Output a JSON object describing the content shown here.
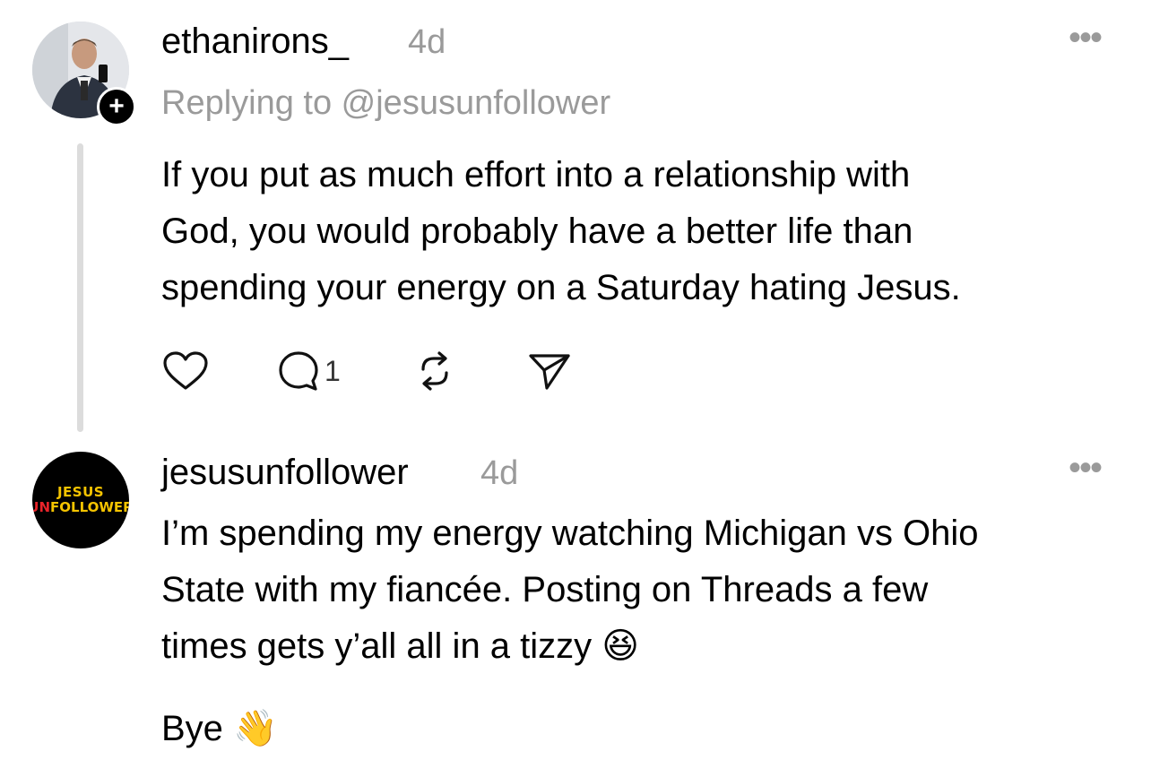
{
  "posts": [
    {
      "username": "ethanirons_",
      "time": "4d",
      "reply_to": "Replying to @jesusunfollower",
      "lines": [
        "If you put as much effort into a relationship with",
        "God, you would probably have a better life than",
        "spending your energy on a Saturday hating Jesus."
      ],
      "reply_count": "1",
      "more_label": "•••"
    },
    {
      "username": "jesusunfollower",
      "time": "4d",
      "lines": [
        "I’m spending my energy watching Michigan vs Ohio",
        "State with my fiancée. Posting on Threads a few",
        "times gets y’all all in a tizzy 😆"
      ],
      "sign_off": "Bye 👋",
      "more_label": "•••",
      "avatar_logo": {
        "line1": "JESUS",
        "line2_a": "UN",
        "line2_b": "FOLLOWER"
      }
    }
  ],
  "follow_badge": "+",
  "colors": {
    "secondary_text": "#9a9a9a",
    "thread_line": "#dcdcdc",
    "logo_yellow": "#f5c400",
    "logo_red": "#e8242a"
  }
}
